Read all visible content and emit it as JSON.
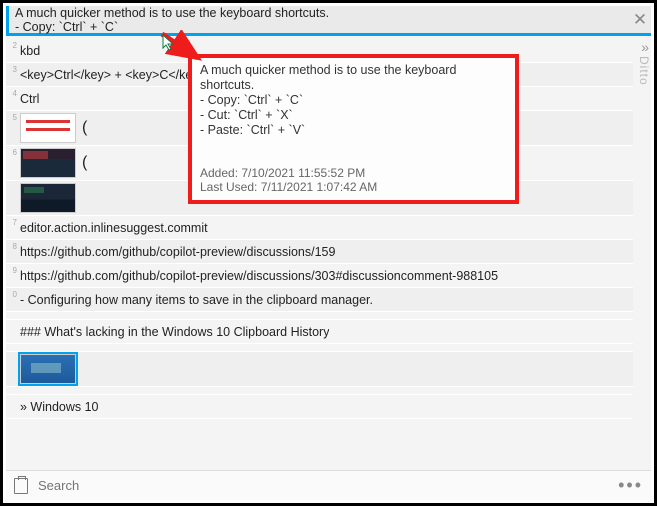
{
  "header": {
    "line1": "A much quicker method is to use the keyboard shortcuts.",
    "line2": " - Copy: `Ctrl` + `C`"
  },
  "close_glyph": "✕",
  "expander_glyph": "»",
  "side_label": "Ditto",
  "rows": [
    {
      "n": "2",
      "text": "kbd"
    },
    {
      "n": "3",
      "text": "<key>Ctrl</key>  +  <key>C</key>"
    },
    {
      "n": "4",
      "text": "Ctrl"
    },
    {
      "n": "5",
      "thumb": "redlines",
      "text": "("
    },
    {
      "n": "6",
      "thumb": "codeA",
      "text": "("
    },
    {
      "n": "",
      "thumb": "codeB",
      "text": ""
    },
    {
      "n": "7",
      "text": "editor.action.inlinesuggest.commit"
    },
    {
      "n": "8",
      "text": "https://github.com/github/copilot-preview/discussions/159"
    },
    {
      "n": "9",
      "text": "https://github.com/github/copilot-preview/discussions/303#discussioncomment-988105"
    },
    {
      "n": "0",
      "text": "- Configuring how many items to save in the clipboard manager."
    },
    {
      "n": "",
      "text": "### What's lacking in the Windows 10 Clipboard History"
    },
    {
      "n": "",
      "thumb": "blue",
      "thumbsel": true,
      "text": ""
    },
    {
      "n": "",
      "text": "» Windows 10"
    }
  ],
  "search_placeholder": "Search",
  "dots": "•••",
  "popup": {
    "l1": "A much quicker method is to use the keyboard shortcuts.",
    "l2": " - Copy: `Ctrl` + `C`",
    "l3": " - Cut: `Ctrl` + `X`",
    "l4": " - Paste: `Ctrl` + `V`",
    "added": "Added: 7/10/2021 11:55:52 PM",
    "last": "Last Used: 7/11/2021 1:07:42 AM"
  },
  "colors": {
    "highlight": "#ef1c1c",
    "accent": "#00a2ed"
  }
}
